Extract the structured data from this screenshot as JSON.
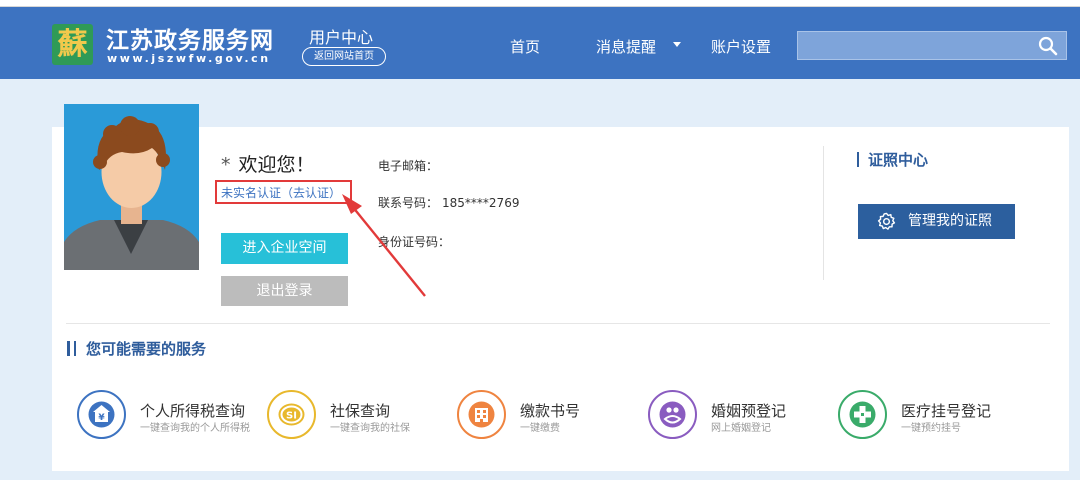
{
  "header": {
    "logo_mark": "蘇",
    "site_name": "江苏政务服务网",
    "site_domain": "www.jszwfw.gov.cn",
    "section_title": "用户中心",
    "back_link": "返回网站首页",
    "nav": [
      {
        "label": "首页"
      },
      {
        "label": "消息提醒"
      },
      {
        "label": "账户设置"
      }
    ],
    "search": {
      "placeholder": "",
      "icon": "search-icon"
    }
  },
  "profile": {
    "welcome_star": "*",
    "welcome": "欢迎您！",
    "cert_status": "未实名认证（去认证）",
    "enterprise_button": "进入企业空间",
    "logout_button": "退出登录",
    "email_label": "电子邮箱：",
    "email_value": "",
    "phone_label": "联系号码：",
    "phone_value": "185****2769",
    "id_label": "身份证号码：",
    "id_value": ""
  },
  "license": {
    "title": "证照中心",
    "button": "管理我的证照",
    "button_icon": "gear-icon"
  },
  "services": {
    "title": "您可能需要的服务",
    "items": [
      {
        "name": "个人所得税查询",
        "desc": "一键查询我的个人所得税",
        "icon": "tax-icon",
        "color": "#3d73c1"
      },
      {
        "name": "社保查询",
        "desc": "一键查询我的社保",
        "icon": "social-security-icon",
        "color": "#e8b82c"
      },
      {
        "name": "缴款书号",
        "desc": "一键缴费",
        "icon": "building-icon",
        "color": "#ef8440"
      },
      {
        "name": "婚姻预登记",
        "desc": "网上婚姻登记",
        "icon": "marriage-icon",
        "color": "#8a5cc0"
      },
      {
        "name": "医疗挂号登记",
        "desc": "一键预约挂号",
        "icon": "medical-icon",
        "color": "#3aab6a"
      }
    ]
  },
  "colors": {
    "header_bg": "#3d73c1",
    "page_bg": "#e3eef9",
    "accent_dark": "#2c5f9e",
    "enterprise_btn": "#27c0d8",
    "logout_btn": "#bcbcbc",
    "alert_red": "#e23a3a"
  }
}
